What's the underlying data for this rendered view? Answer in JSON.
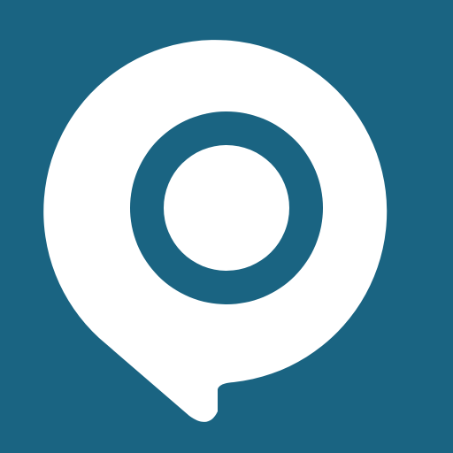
{
  "icon": {
    "name": "location-pin-chat-bubble-icon",
    "colors": {
      "background": "#1A6482",
      "bubble": "#FFFFFF",
      "ring": "#1A6482",
      "ring_center": "#FFFFFF"
    }
  }
}
